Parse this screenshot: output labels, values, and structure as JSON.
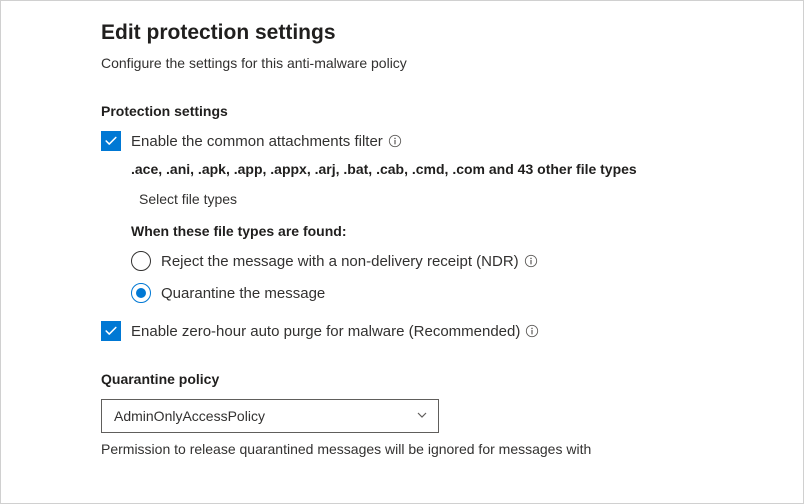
{
  "header": {
    "title": "Edit protection settings",
    "subtitle": "Configure the settings for this anti-malware policy"
  },
  "protection": {
    "heading": "Protection settings",
    "enable_common_filter_label": "Enable the common attachments filter",
    "file_types": ".ace, .ani, .apk, .app, .appx, .arj, .bat, .cab, .cmd, .com and 43 other file types",
    "select_file_types": "Select file types",
    "when_found_heading": "When these file types are found:",
    "radio_reject_label": "Reject the message with a non-delivery receipt (NDR)",
    "radio_quarantine_label": "Quarantine the message",
    "enable_zap_label": "Enable zero-hour auto purge for malware (Recommended)"
  },
  "quarantine": {
    "heading": "Quarantine policy",
    "selected_policy": "AdminOnlyAccessPolicy",
    "note": "Permission to release quarantined messages will be ignored for messages with"
  }
}
